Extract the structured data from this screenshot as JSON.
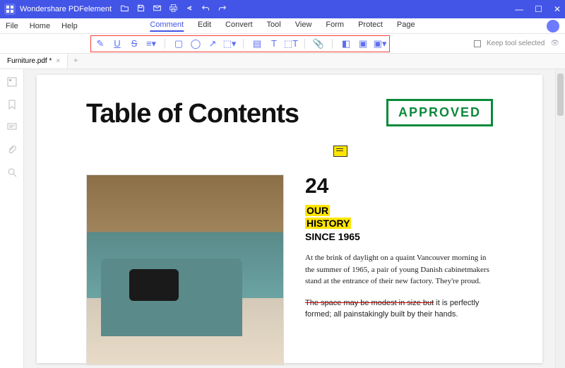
{
  "titlebar": {
    "app_name": "Wondershare PDFelement"
  },
  "menubar": {
    "left": [
      "File",
      "Home",
      "Help"
    ],
    "center": [
      "Comment",
      "Edit",
      "Convert",
      "Tool",
      "View",
      "Form",
      "Protect",
      "Page"
    ],
    "active": "Comment"
  },
  "toolbar": {
    "keep_tool_label": "Keep tool selected"
  },
  "tabs": {
    "items": [
      {
        "label": "Furniture.pdf *"
      }
    ]
  },
  "document": {
    "toc_title": "Table of Contents",
    "stamp": "APPROVED",
    "number": "24",
    "heading_line1": "OUR",
    "heading_line2": "HISTORY",
    "since": "SINCE 1965",
    "para1": "At the brink of daylight on a quaint Vancouver morning in the summer of 1965, a pair of young Danish cabinetmakers stand at the entrance of their new factory. They're proud.",
    "para2_strike": "The space may be modest in size but",
    "para2_rest": " it is perfectly formed; all painstakingly built by their hands."
  }
}
